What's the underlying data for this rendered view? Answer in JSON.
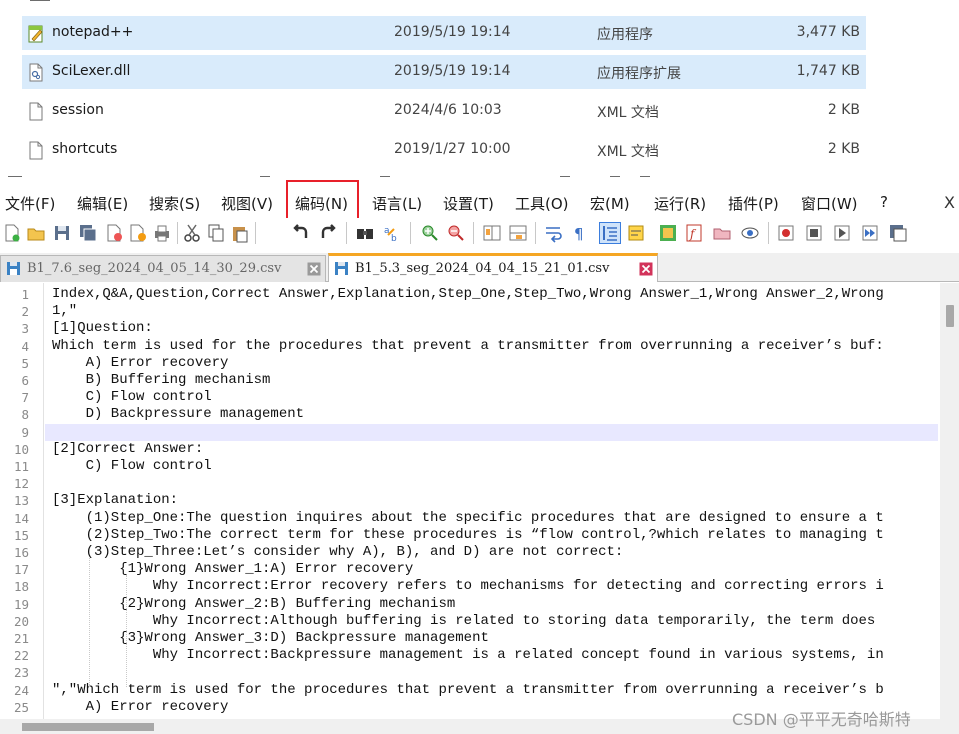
{
  "explorer": {
    "files": [
      {
        "name": "notepad++",
        "date": "2019/5/19 19:14",
        "type": "应用程序",
        "size": "3,477 KB",
        "icon": "notepadpp-app-icon",
        "selected": true
      },
      {
        "name": "SciLexer.dll",
        "date": "2019/5/19 19:14",
        "type": "应用程序扩展",
        "size": "1,747 KB",
        "icon": "dll-file-icon",
        "selected": true
      },
      {
        "name": "session",
        "date": "2024/4/6 10:03",
        "type": "XML 文档",
        "size": "2 KB",
        "icon": "document-icon",
        "selected": false
      },
      {
        "name": "shortcuts",
        "date": "2019/1/27 10:00",
        "type": "XML 文档",
        "size": "2 KB",
        "icon": "document-icon",
        "selected": false
      }
    ]
  },
  "menubar": {
    "items": [
      "文件(F)",
      "编辑(E)",
      "搜索(S)",
      "视图(V)",
      "编码(N)",
      "语言(L)",
      "设置(T)",
      "工具(O)",
      "宏(M)",
      "运行(R)",
      "插件(P)",
      "窗口(W)",
      "?"
    ],
    "close": "X",
    "highlighted": "编码(N)",
    "highlight_color": "#e8202a"
  },
  "tabs": [
    {
      "label": "B1_7.6_seg_2024_04_05_14_30_29.csv",
      "active": false
    },
    {
      "label": "B1_5.3_seg_2024_04_04_15_21_01.csv",
      "active": true
    }
  ],
  "editor": {
    "current_line": 9,
    "lines": [
      "Index,Q&A,Question,Correct Answer,Explanation,Step_One,Step_Two,Wrong Answer_1,Wrong Answer_2,Wrong",
      "1,\"",
      "[1]Question:",
      "Which term is used for the procedures that prevent a transmitter from overrunning a receiver’s buf:",
      "    A) Error recovery",
      "    B) Buffering mechanism",
      "    C) Flow control",
      "    D) Backpressure management",
      "",
      "[2]Correct Answer:",
      "    C) Flow control",
      "",
      "[3]Explanation:",
      "    (1)Step_One:The question inquires about the specific procedures that are designed to ensure a t",
      "    (2)Step_Two:The correct term for these procedures is “flow control,?which relates to managing t",
      "    (3)Step_Three:Let’s consider why A), B), and D) are not correct:",
      "        {1}Wrong Answer_1:A) Error recovery",
      "            Why Incorrect:Error recovery refers to mechanisms for detecting and correcting errors i",
      "        {2}Wrong Answer_2:B) Buffering mechanism",
      "            Why Incorrect:Although buffering is related to storing data temporarily, the term does",
      "        {3}Wrong Answer_3:D) Backpressure management",
      "            Why Incorrect:Backpressure management is a related concept found in various systems, in",
      "",
      "\",\"Which term is used for the procedures that prevent a transmitter from overrunning a receiver’s b",
      "    A) Error recovery"
    ]
  },
  "watermark": "CSDN @平平无奇哈斯特"
}
